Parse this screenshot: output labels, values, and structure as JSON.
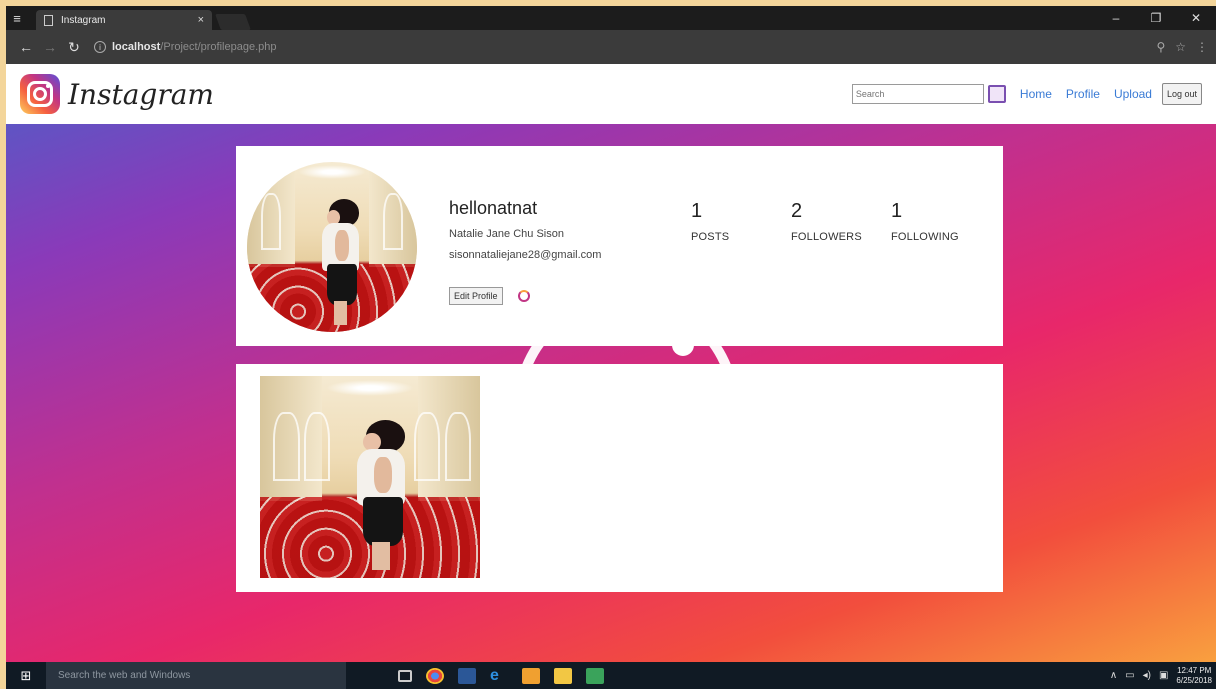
{
  "browser": {
    "tab_title": "Instagram",
    "tab_close": "×",
    "url_host": "localhost",
    "url_path": "/Project/profilepage.php",
    "win_minimize": "–",
    "win_maximize": "❐",
    "win_close": "✕"
  },
  "navbar": {
    "brand": "Instagram",
    "search_placeholder": "Search",
    "links": {
      "home": "Home",
      "profile": "Profile",
      "upload": "Upload"
    },
    "logout_label": "Log out"
  },
  "profile": {
    "username": "hellonatnat",
    "full_name": "Natalie Jane Chu Sison",
    "email": "sisonnataliejane28@gmail.com",
    "edit_label": "Edit Profile",
    "stats": [
      {
        "value": "1",
        "label": "POSTS"
      },
      {
        "value": "2",
        "label": "FOLLOWERS"
      },
      {
        "value": "1",
        "label": "FOLLOWING"
      }
    ]
  },
  "taskbar": {
    "search_text": "Search the web and Windows",
    "time": "12:47 PM",
    "date": "6/25/2018"
  },
  "colors": {
    "link": "#3a7bd5",
    "gradient_start": "#4e5fc8",
    "gradient_mid": "#e8276a",
    "gradient_end": "#f9a03f"
  }
}
